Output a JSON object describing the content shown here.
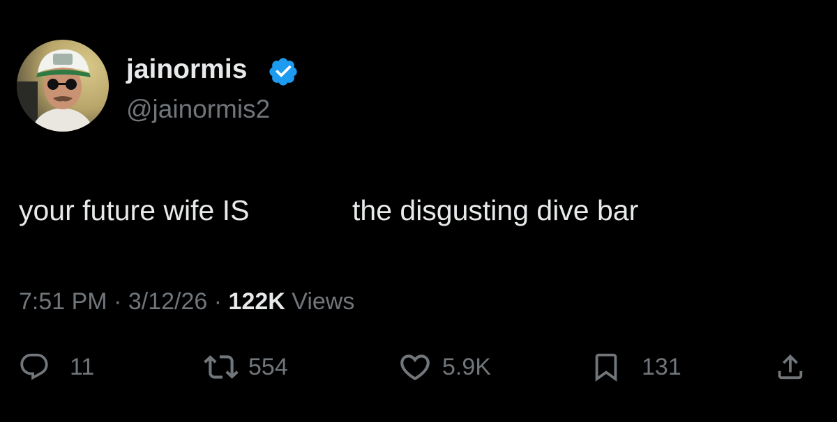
{
  "author": {
    "display_name": "jainormis",
    "handle": "@jainormis2",
    "verified": true,
    "avatar_icon": "avatar-photo"
  },
  "tweet": {
    "text_part1": "your future wife IS",
    "text_part2": "the disgusting dive bar"
  },
  "meta": {
    "time": "7:51 PM",
    "separator": "·",
    "date": "3/12/26",
    "views_count": "122K",
    "views_label": "Views"
  },
  "actions": {
    "reply_count": "11",
    "retweet_count": "554",
    "like_count": "5.9K",
    "bookmark_count": "131"
  },
  "colors": {
    "background": "#000000",
    "primary_text": "#e7e9ea",
    "secondary_text": "#71767b",
    "verified_blue": "#1d9bf0"
  }
}
